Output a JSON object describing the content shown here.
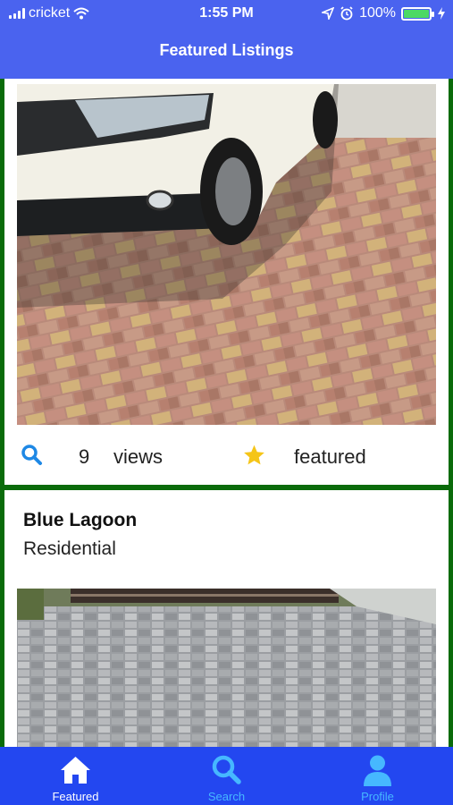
{
  "status_bar": {
    "carrier": "cricket",
    "time": "1:55 PM",
    "battery": "100%"
  },
  "header": {
    "title": "Featured Listings"
  },
  "listings": [
    {
      "views_count": "9",
      "views_label": "views",
      "featured_label": "featured",
      "image": "car-on-brick-driveway"
    },
    {
      "name": "Blue Lagoon",
      "type": "Residential",
      "image": "gray-paver-driveway"
    }
  ],
  "tabbar": {
    "items": [
      {
        "label": "Featured",
        "icon": "home-icon",
        "active": true
      },
      {
        "label": "Search",
        "icon": "search-icon",
        "active": false
      },
      {
        "label": "Profile",
        "icon": "profile-icon",
        "active": false
      }
    ]
  },
  "colors": {
    "header": "#4a63ef",
    "tabbar": "#2347f0",
    "tab_inactive": "#46b8ff",
    "card_border": "#0a6b0a",
    "star": "#f5c518",
    "search_icon": "#1e88e5"
  }
}
